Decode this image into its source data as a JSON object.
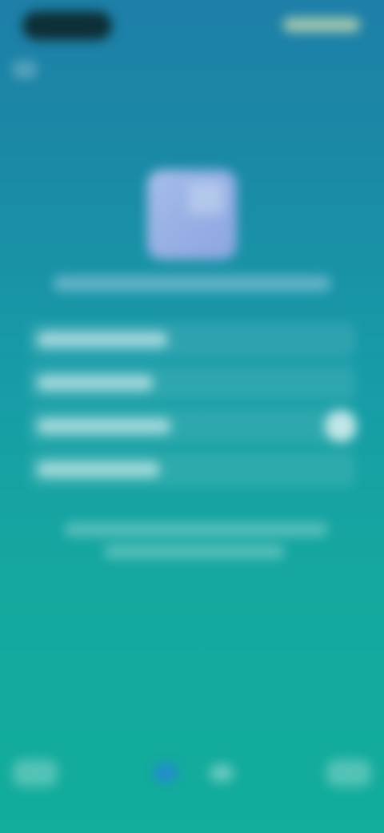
{
  "screen": {
    "blurred": true
  },
  "status_bar": {
    "left_icon": "camera-pill-icon",
    "right_icon": "status-icons"
  },
  "header": {
    "back_icon": "back-arrow-icon"
  },
  "content": {
    "logo_icon": "image-placeholder-icon",
    "title": "",
    "options": [
      {
        "label": ""
      },
      {
        "label": ""
      },
      {
        "label": ""
      },
      {
        "label": ""
      }
    ],
    "toggle_state": "on",
    "note_line_1": "",
    "note_line_2": ""
  },
  "dock": {
    "left_button": "",
    "right_button": "",
    "pager_active": 0,
    "pager_count": 2
  },
  "colors": {
    "bg_top": "#1e7fa8",
    "bg_bottom": "#12ad9b",
    "logo": "#a9b7ee",
    "active_dot": "#2882dc"
  }
}
